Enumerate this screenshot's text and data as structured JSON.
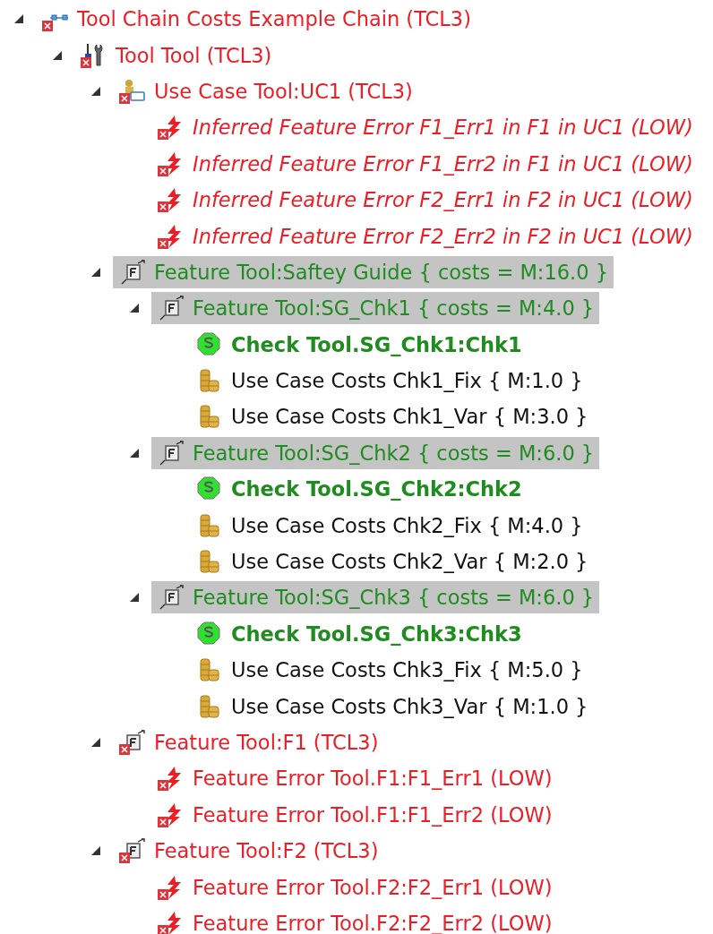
{
  "tree": [
    {
      "label": "Tool Chain Costs Example Chain (TCL3)",
      "kind": "chain",
      "color": "#ee1c24",
      "error": true,
      "selected": false,
      "expanded": true,
      "children": [
        {
          "label": "Tool Tool (TCL3)",
          "kind": "tool",
          "color": "#ee1c24",
          "error": true,
          "selected": false,
          "expanded": true,
          "children": [
            {
              "label": "Use Case Tool:UC1 (TCL3)",
              "kind": "usecase",
              "color": "#ee1c24",
              "error": true,
              "selected": false,
              "expanded": true,
              "children": [
                {
                  "label": "Inferred Feature Error F1_Err1 in F1 in UC1 (LOW)",
                  "kind": "inferred-error",
                  "color": "#ee1c24",
                  "error": true,
                  "selected": false
                },
                {
                  "label": "Inferred Feature Error F1_Err2 in F1 in UC1 (LOW)",
                  "kind": "inferred-error",
                  "color": "#ee1c24",
                  "error": true,
                  "selected": false
                },
                {
                  "label": "Inferred Feature Error F2_Err1 in F2 in UC1 (LOW)",
                  "kind": "inferred-error",
                  "color": "#ee1c24",
                  "error": true,
                  "selected": false
                },
                {
                  "label": "Inferred Feature Error F2_Err2 in F2 in UC1 (LOW)",
                  "kind": "inferred-error",
                  "color": "#ee1c24",
                  "error": true,
                  "selected": false
                }
              ]
            },
            {
              "label": "Feature Tool:Saftey Guide { costs = M:16.0 }",
              "kind": "feature",
              "color": "#1e8c1e",
              "error": false,
              "selected": true,
              "expanded": true,
              "children": [
                {
                  "label": "Feature Tool:SG_Chk1 { costs = M:4.0 }",
                  "kind": "feature",
                  "color": "#1e8c1e",
                  "error": false,
                  "selected": true,
                  "expanded": true,
                  "children": [
                    {
                      "label": "Check Tool.SG_Chk1:Chk1",
                      "kind": "check",
                      "color": "#1e8c1e",
                      "error": false,
                      "selected": false
                    },
                    {
                      "label": "Use Case Costs Chk1_Fix { M:1.0 }",
                      "kind": "cost",
                      "color": "#111111",
                      "error": false,
                      "selected": false
                    },
                    {
                      "label": "Use Case Costs Chk1_Var { M:3.0 }",
                      "kind": "cost",
                      "color": "#111111",
                      "error": false,
                      "selected": false
                    }
                  ]
                },
                {
                  "label": "Feature Tool:SG_Chk2 { costs = M:6.0 }",
                  "kind": "feature",
                  "color": "#1e8c1e",
                  "error": false,
                  "selected": true,
                  "expanded": true,
                  "children": [
                    {
                      "label": "Check Tool.SG_Chk2:Chk2",
                      "kind": "check",
                      "color": "#1e8c1e",
                      "error": false,
                      "selected": false
                    },
                    {
                      "label": "Use Case Costs Chk2_Fix { M:4.0 }",
                      "kind": "cost",
                      "color": "#111111",
                      "error": false,
                      "selected": false
                    },
                    {
                      "label": "Use Case Costs Chk2_Var { M:2.0 }",
                      "kind": "cost",
                      "color": "#111111",
                      "error": false,
                      "selected": false
                    }
                  ]
                },
                {
                  "label": "Feature Tool:SG_Chk3 { costs = M:6.0 }",
                  "kind": "feature",
                  "color": "#1e8c1e",
                  "error": false,
                  "selected": true,
                  "expanded": true,
                  "children": [
                    {
                      "label": "Check Tool.SG_Chk3:Chk3",
                      "kind": "check",
                      "color": "#1e8c1e",
                      "error": false,
                      "selected": false
                    },
                    {
                      "label": "Use Case Costs Chk3_Fix { M:5.0 }",
                      "kind": "cost",
                      "color": "#111111",
                      "error": false,
                      "selected": false
                    },
                    {
                      "label": "Use Case Costs Chk3_Var { M:1.0 }",
                      "kind": "cost",
                      "color": "#111111",
                      "error": false,
                      "selected": false
                    }
                  ]
                }
              ]
            },
            {
              "label": "Feature Tool:F1 (TCL3)",
              "kind": "feature",
              "color": "#ee1c24",
              "error": true,
              "selected": false,
              "expanded": true,
              "children": [
                {
                  "label": "Feature Error Tool.F1:F1_Err1 (LOW)",
                  "kind": "error",
                  "color": "#ee1c24",
                  "error": true,
                  "selected": false
                },
                {
                  "label": "Feature Error Tool.F1:F1_Err2 (LOW)",
                  "kind": "error",
                  "color": "#ee1c24",
                  "error": true,
                  "selected": false
                }
              ]
            },
            {
              "label": "Feature Tool:F2 (TCL3)",
              "kind": "feature",
              "color": "#ee1c24",
              "error": true,
              "selected": false,
              "expanded": true,
              "children": [
                {
                  "label": "Feature Error Tool.F2:F2_Err1 (LOW)",
                  "kind": "error",
                  "color": "#ee1c24",
                  "error": true,
                  "selected": false
                },
                {
                  "label": "Feature Error Tool.F2:F2_Err2 (LOW)",
                  "kind": "error",
                  "color": "#ee1c24",
                  "error": true,
                  "selected": false
                }
              ]
            }
          ]
        }
      ]
    }
  ]
}
